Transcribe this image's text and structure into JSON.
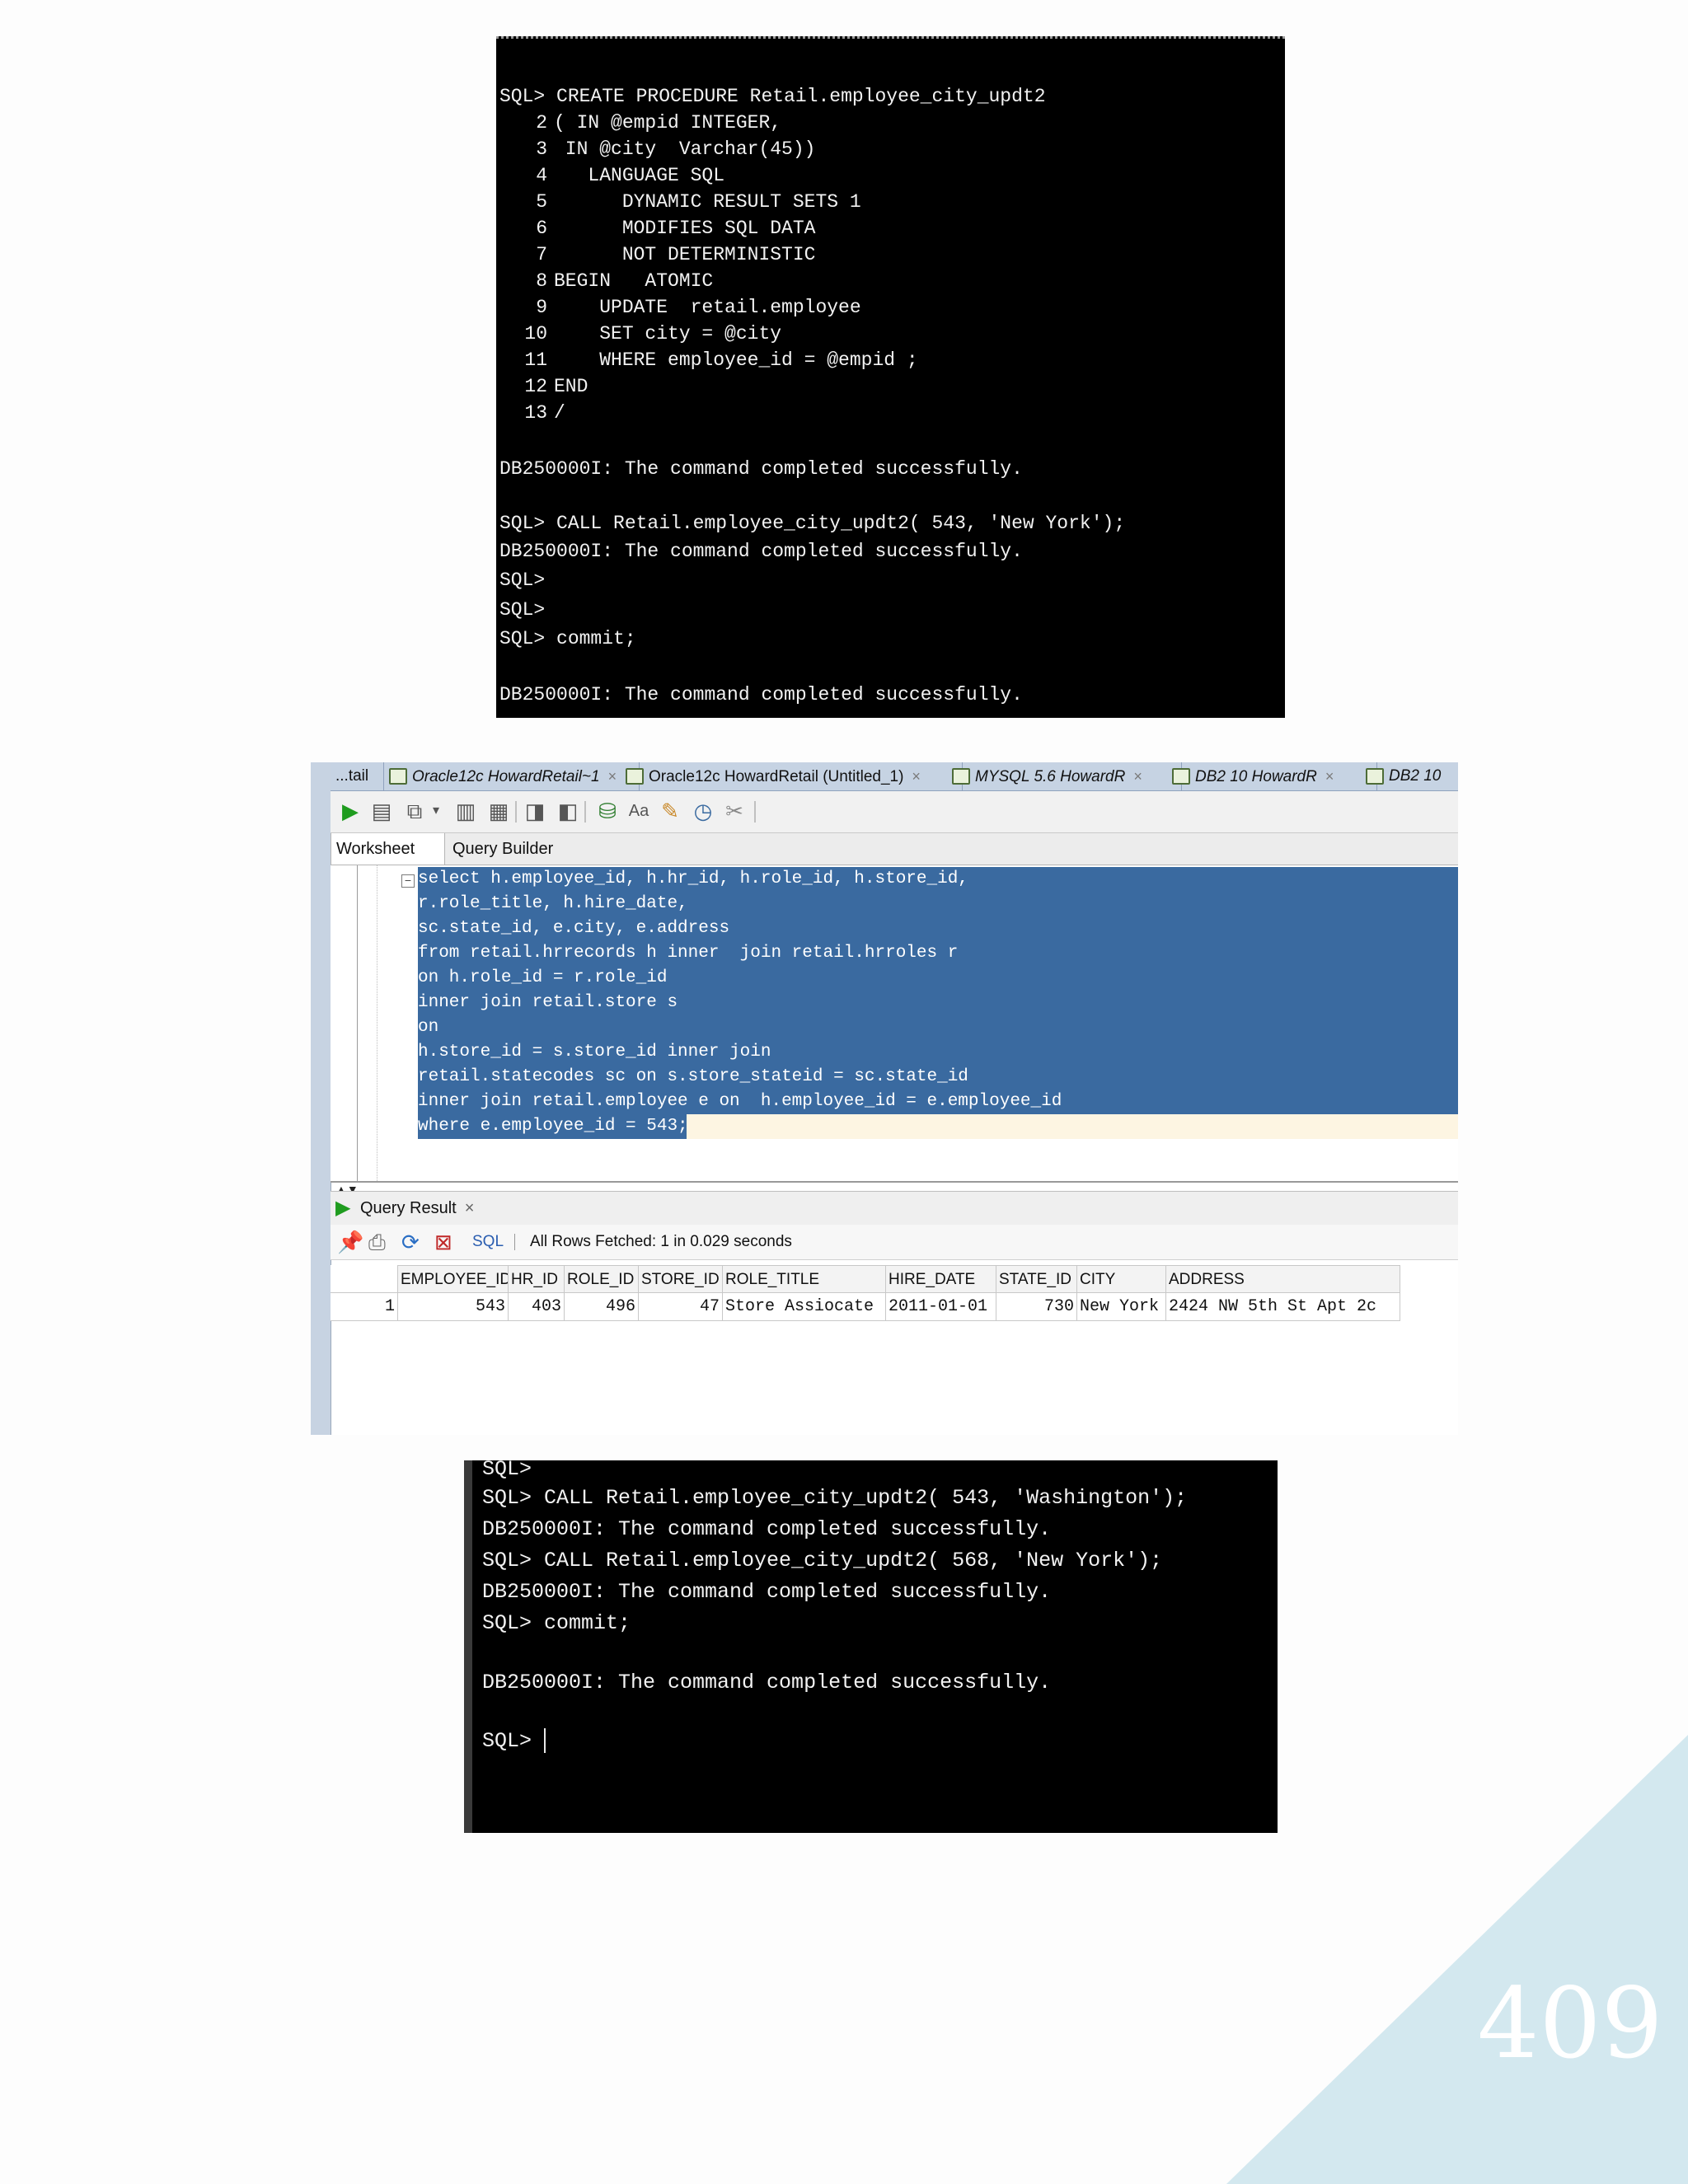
{
  "console1": {
    "lines": [
      "SQL> CREATE PROCEDURE Retail.employee_city_updt2",
      "( IN @empid INTEGER,",
      " IN @city  Varchar(45))",
      "   LANGUAGE SQL",
      "      DYNAMIC RESULT SETS 1",
      "      MODIFIES SQL DATA",
      "      NOT DETERMINISTIC",
      "BEGIN   ATOMIC",
      "    UPDATE  retail.employee",
      "    SET city = @city",
      "    WHERE employee_id = @empid ;",
      "END",
      "/",
      "DB250000I: The command completed successfully.",
      "SQL> CALL Retail.employee_city_updt2( 543, 'New York');",
      "DB250000I: The command completed successfully.",
      "SQL>",
      "SQL>",
      "SQL> commit;",
      "DB250000I: The command completed successfully."
    ],
    "line_numbers": [
      "2",
      "3",
      "4",
      "5",
      "6",
      "7",
      "8",
      "9",
      "10",
      "11",
      "12",
      "13"
    ]
  },
  "ide": {
    "tabs": [
      {
        "label": "...tail"
      },
      {
        "label": "Oracle12c HowardRetail~1"
      },
      {
        "label": "Oracle12c HowardRetail (Untitled_1)"
      },
      {
        "label": "MYSQL 5.6 HowardR"
      },
      {
        "label": "DB2 10 HowardR"
      },
      {
        "label": "DB2 10"
      }
    ],
    "close_glyph": "×",
    "subtabs": {
      "worksheet": "Worksheet",
      "query_builder": "Query Builder"
    },
    "code_lines": [
      "select h.employee_id, h.hr_id, h.role_id, h.store_id,",
      "r.role_title, h.hire_date,",
      "sc.state_id, e.city, e.address",
      "from retail.hrrecords h inner  join retail.hrroles r",
      "on h.role_id = r.role_id",
      "inner join retail.store s",
      "on",
      "h.store_id = s.store_id inner join",
      "retail.statecodes sc on s.store_stateid = sc.state_id",
      "inner join retail.employee e on  h.employee_id = e.employee_id",
      "where e.employee_id = 543;"
    ],
    "fold_glyph": "−",
    "result_tab": {
      "label": "Query Result",
      "close": "×"
    },
    "sql_link": "SQL",
    "status": "All Rows Fetched: 1 in 0.029 seconds",
    "grid": {
      "columns": [
        "EMPLOYEE_ID",
        "HR_ID",
        "ROLE_ID",
        "STORE_ID",
        "ROLE_TITLE",
        "HIRE_DATE",
        "STATE_ID",
        "CITY",
        "ADDRESS"
      ],
      "rows": [
        {
          "rownum": "1",
          "cells": [
            "543",
            "403",
            "496",
            "47",
            "Store Assiocate",
            "2011-01-01",
            "730",
            "New York",
            "2424 NW 5th St Apt 2c"
          ]
        }
      ]
    }
  },
  "console2": {
    "lines": [
      "SQL>",
      "SQL> CALL Retail.employee_city_updt2( 543, 'Washington');",
      "DB250000I: The command completed successfully.",
      "SQL> CALL Retail.employee_city_updt2( 568, 'New York');",
      "DB250000I: The command completed successfully.",
      "SQL> commit;",
      "DB250000I: The command completed successfully.",
      "SQL> "
    ]
  },
  "page_number": "409",
  "colors": {
    "selection": "#3a6aa0",
    "corner": "#d3e8ef",
    "run_green": "#1f9c1f"
  }
}
